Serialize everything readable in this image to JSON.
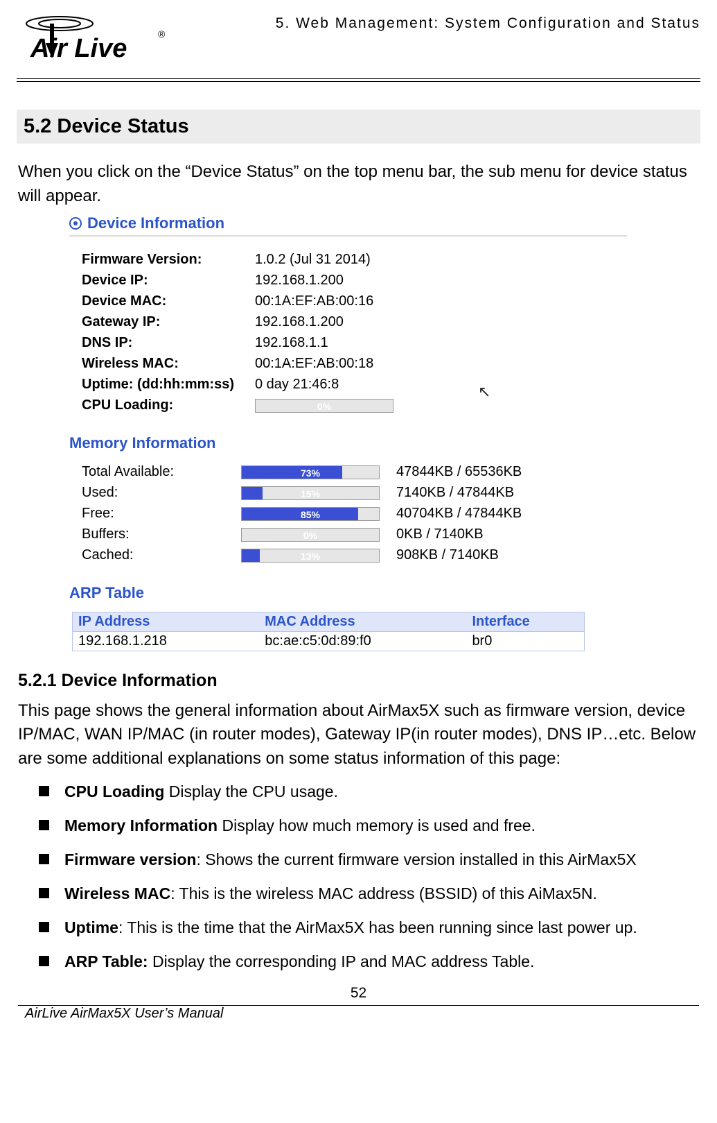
{
  "header": {
    "breadcrumb": "5.  Web  Management:  System  Configuration  and  Status",
    "logo_main": "Air Live",
    "logo_mark": "®"
  },
  "section": {
    "title": "5.2 Device Status",
    "intro": "When you click on the “Device Status” on the top menu bar, the sub menu for device status will appear."
  },
  "screenshot": {
    "device_info_title": "Device Information",
    "device_info": {
      "rows": [
        {
          "label": "Firmware Version:",
          "value": "1.0.2 (Jul 31 2014)"
        },
        {
          "label": "Device IP:",
          "value": "192.168.1.200"
        },
        {
          "label": "Device MAC:",
          "value": "00:1A:EF:AB:00:16"
        },
        {
          "label": "Gateway IP:",
          "value": "192.168.1.200"
        },
        {
          "label": "DNS IP:",
          "value": "192.168.1.1"
        },
        {
          "label": "Wireless MAC:",
          "value": "00:1A:EF:AB:00:18"
        },
        {
          "label": "Uptime: (dd:hh:mm:ss)",
          "value": "0 day 21:46:8"
        }
      ],
      "cpu_label": "CPU Loading:",
      "cpu_percent": 0,
      "cpu_text": "0%"
    },
    "memory_title": "Memory Information",
    "memory": {
      "rows": [
        {
          "label": "Total Available:",
          "percent": 73,
          "text": "73%",
          "value": "47844KB / 65536KB"
        },
        {
          "label": "Used:",
          "percent": 15,
          "text": "15%",
          "value": "7140KB / 47844KB"
        },
        {
          "label": "Free:",
          "percent": 85,
          "text": "85%",
          "value": "40704KB / 47844KB"
        },
        {
          "label": "Buffers:",
          "percent": 0,
          "text": "0%",
          "value": "0KB / 7140KB"
        },
        {
          "label": "Cached:",
          "percent": 13,
          "text": "13%",
          "value": "908KB / 7140KB"
        }
      ]
    },
    "arp_title": "ARP Table",
    "arp": {
      "headers": [
        "IP Address",
        "MAC Address",
        "Interface"
      ],
      "rows": [
        {
          "ip": "192.168.1.218",
          "mac": "bc:ae:c5:0d:89:f0",
          "iface": "br0"
        }
      ]
    }
  },
  "subsection": {
    "title": "5.2.1 Device Information",
    "para": "This page shows the general information about AirMax5X such as firmware version, device IP/MAC, WAN IP/MAC (in router modes), Gateway IP(in router modes), DNS IP…etc. Below are some additional explanations on some status information of this page:",
    "bullets": [
      {
        "bold": "CPU Loading",
        "rest": " Display the CPU usage."
      },
      {
        "bold": "Memory Information",
        "rest": " Display how much memory is used and free."
      },
      {
        "bold": "Firmware version",
        "rest": ": Shows the current firmware version installed in this AirMax5X"
      },
      {
        "bold": "Wireless MAC",
        "rest": ": This is the wireless MAC address (BSSID) of this AiMax5N."
      },
      {
        "bold": "Uptime",
        "rest": ": This is the time that the AirMax5X has been running since last power up."
      },
      {
        "bold": "ARP Table:",
        "rest": " Display the corresponding IP and MAC address Table."
      }
    ]
  },
  "footer": {
    "page_num": "52",
    "manual": "AirLive AirMax5X User’s Manual"
  }
}
